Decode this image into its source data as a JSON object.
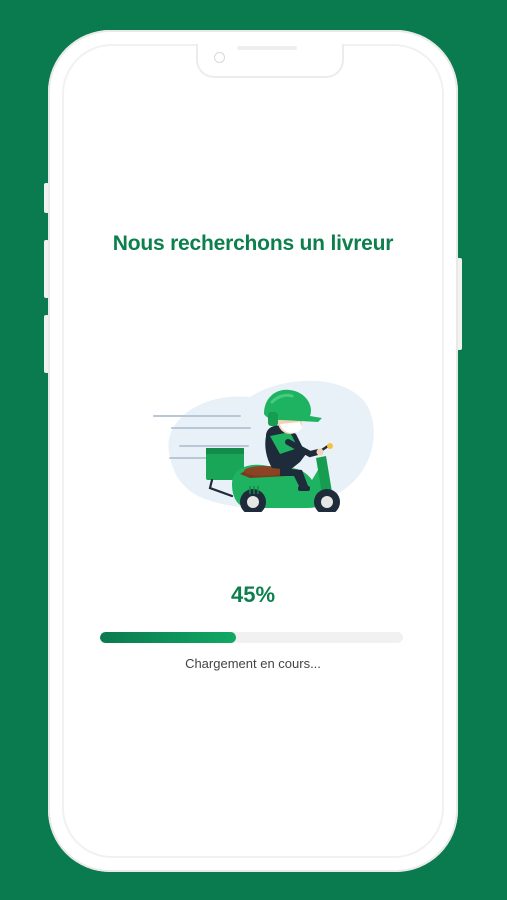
{
  "colors": {
    "background": "#0a7a4f",
    "accent": "#0c7f4d",
    "progress_track": "#f1f1f1"
  },
  "screen": {
    "title": "Nous recherchons un livreur",
    "illustration": "delivery-scooter-rider-icon",
    "progress": {
      "percent_label": "45%",
      "value": 0.45
    },
    "status_text": "Chargement en cours..."
  }
}
